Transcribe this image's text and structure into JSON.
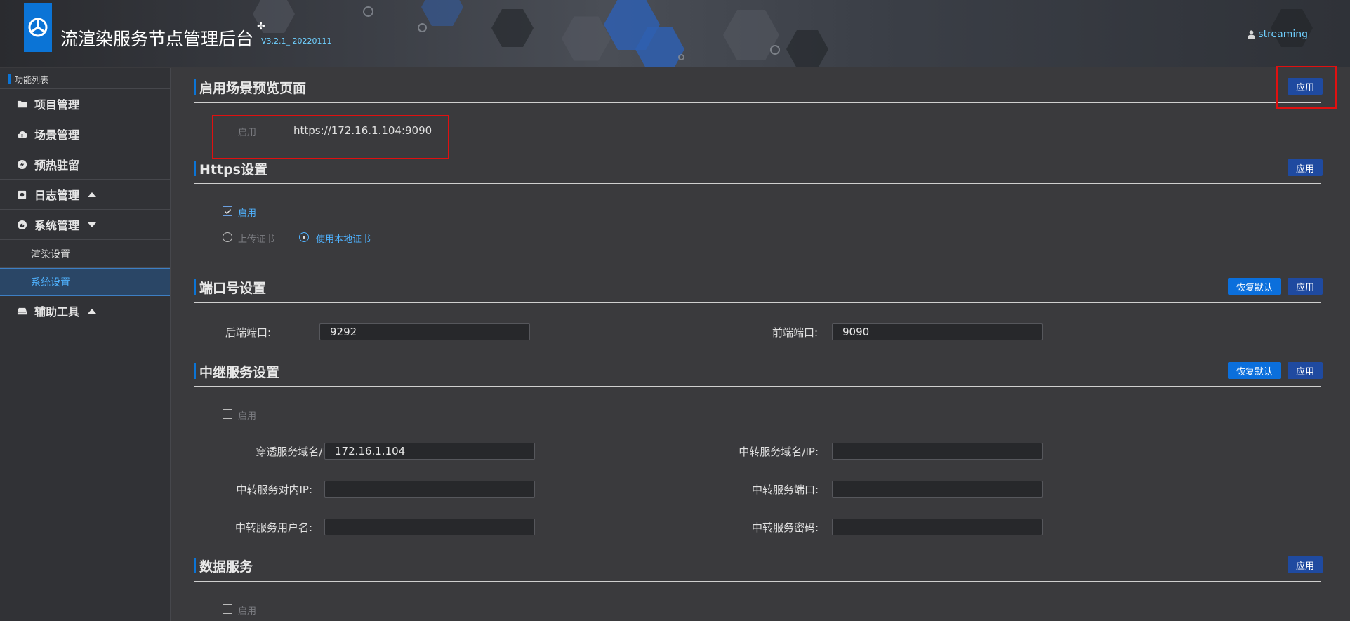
{
  "header": {
    "app_title": "流渲染服务节点管理后台",
    "sparkle": "✢",
    "version": "V3.2.1_ 20220111",
    "user_name": "streaming"
  },
  "sidebar": {
    "heading": "功能列表",
    "items": [
      {
        "label": "项目管理",
        "icon": "folder-icon"
      },
      {
        "label": "场景管理",
        "icon": "cloud-upload-icon"
      },
      {
        "label": "预热驻留",
        "icon": "bolt-icon"
      },
      {
        "label": "日志管理",
        "icon": "log-icon",
        "caret": "up"
      },
      {
        "label": "系统管理",
        "icon": "dashboard-icon",
        "caret": "down"
      },
      {
        "label": "辅助工具",
        "icon": "drive-icon",
        "caret": "up"
      }
    ],
    "sub_items": [
      {
        "label": "渲染设置",
        "active": false
      },
      {
        "label": "系统设置",
        "active": true
      }
    ]
  },
  "sections": {
    "preview": {
      "title": "启用场景预览页面",
      "apply": "应用",
      "enable_label": "启用",
      "enable_checked": false,
      "url": "https://172.16.1.104:9090"
    },
    "https": {
      "title": "Https设置",
      "apply": "应用",
      "enable_label": "启用",
      "enable_checked": true,
      "radio_upload": "上传证书",
      "radio_local": "使用本地证书",
      "selected": "使用本地证书"
    },
    "ports": {
      "title": "端口号设置",
      "restore": "恢复默认",
      "apply": "应用",
      "backend_label": "后端端口:",
      "backend_value": "9292",
      "frontend_label": "前端端口:",
      "frontend_value": "9090"
    },
    "relay": {
      "title": "中继服务设置",
      "restore": "恢复默认",
      "apply": "应用",
      "enable_label": "启用",
      "enable_checked": false,
      "penetrate_label": "穿透服务域名/IP:",
      "penetrate_value": "172.16.1.104",
      "relay_domain_label": "中转服务域名/IP:",
      "relay_domain_value": "",
      "relay_inner_ip_label": "中转服务对内IP:",
      "relay_inner_ip_value": "",
      "relay_port_label": "中转服务端口:",
      "relay_port_value": "",
      "relay_user_label": "中转服务用户名:",
      "relay_user_value": "",
      "relay_password_label": "中转服务密码:",
      "relay_password_value": ""
    },
    "data": {
      "title": "数据服务",
      "apply": "应用",
      "enable_label": "启用",
      "enable_checked": false
    }
  },
  "colors": {
    "accent": "#0b74d6",
    "apply_button": "#1f4aa0",
    "restore_button": "#0b6fdc",
    "highlight": "#e01010",
    "link_blue": "#4fb2ff"
  }
}
